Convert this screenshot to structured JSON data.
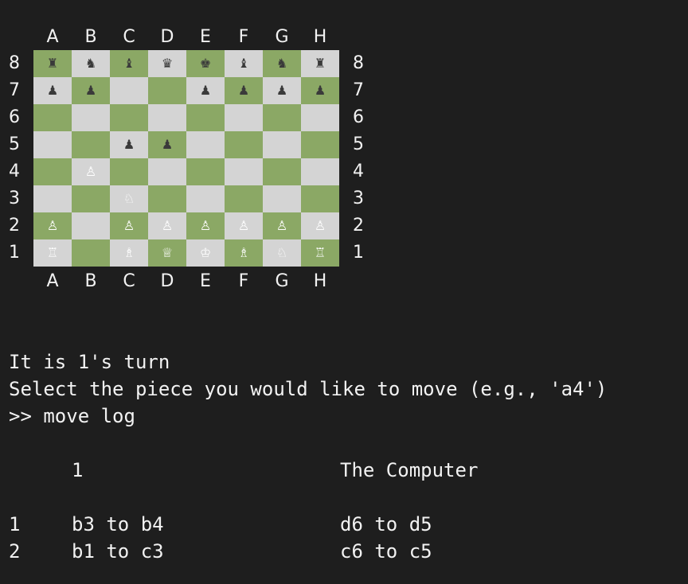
{
  "files": [
    "A",
    "B",
    "C",
    "D",
    "E",
    "F",
    "G",
    "H"
  ],
  "ranks": [
    "8",
    "7",
    "6",
    "5",
    "4",
    "3",
    "2",
    "1"
  ],
  "board": [
    [
      "♜",
      "♞",
      "♝",
      "♛",
      "♚",
      "♝",
      "♞",
      "♜"
    ],
    [
      "♟",
      "♟",
      "",
      "",
      "♟",
      "♟",
      "♟",
      "♟"
    ],
    [
      "",
      "",
      "",
      "",
      "",
      "",
      "",
      ""
    ],
    [
      "",
      "",
      "♟",
      "♟",
      "",
      "",
      "",
      ""
    ],
    [
      "",
      "♙",
      "",
      "",
      "",
      "",
      "",
      ""
    ],
    [
      "",
      "",
      "♘",
      "",
      "",
      "",
      "",
      ""
    ],
    [
      "♙",
      "",
      "♙",
      "♙",
      "♙",
      "♙",
      "♙",
      "♙"
    ],
    [
      "♖",
      "",
      "♗",
      "♕",
      "♔",
      "♗",
      "♘",
      "♖"
    ]
  ],
  "colors": {
    "light": "#d4d4d4",
    "dark": "#8ba865",
    "background": "#1e1e1e"
  },
  "status": {
    "turn": "It is 1's turn",
    "prompt": "Select the piece you would like to move (e.g., 'a4')",
    "command": ">> move log"
  },
  "log": {
    "player1": "1",
    "player2": "The Computer",
    "moves": [
      {
        "num": "1",
        "p1": "b3 to b4",
        "p2": "d6 to d5"
      },
      {
        "num": "2",
        "p1": "b1 to c3",
        "p2": "c6 to c5"
      }
    ]
  }
}
